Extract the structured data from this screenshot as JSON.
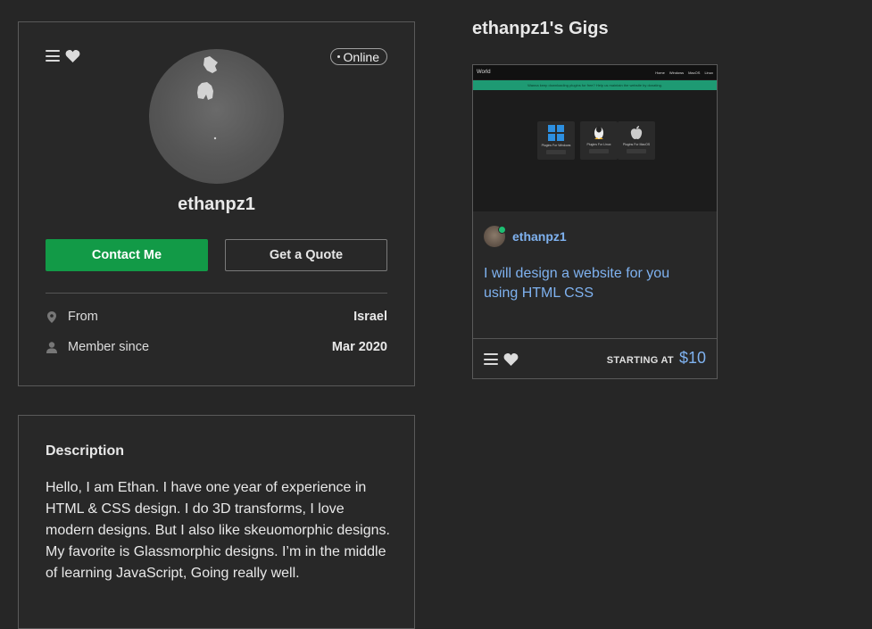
{
  "profile": {
    "status": "Online",
    "username": "ethanpz1",
    "contact_label": "Contact Me",
    "quote_label": "Get a Quote",
    "info": [
      {
        "icon": "location-pin-icon",
        "label": "From",
        "value": "Israel"
      },
      {
        "icon": "user-icon",
        "label": "Member since",
        "value": "Mar 2020"
      }
    ]
  },
  "description": {
    "title": "Description",
    "text": "Hello, I am Ethan. I have one year of experience in HTML & CSS design. I do 3D transforms, I love modern designs. But I also like skeuomorphic designs. My favorite is Glassmorphic designs. I’m in the middle of learning JavaScript, Going really well."
  },
  "gigs": {
    "title": "ethanpz1's Gigs",
    "items": [
      {
        "thumbnail": {
          "site_title": "World",
          "nav_links": [
            "Home",
            "Windows",
            "MacOS",
            "Linux"
          ],
          "banner": "Wanna keep downloading plugins for free? Help us maintain the website by donating.",
          "boxes": [
            "Plugins For Windows",
            "Plugins For Linux",
            "Plugins For MacOS"
          ]
        },
        "seller": "ethanpz1",
        "title": "I will design a website for you using HTML CSS",
        "starting_label": "STARTING AT",
        "price": "$10"
      }
    ]
  },
  "colors": {
    "background": "#262626",
    "accent_green": "#129a47",
    "link_blue": "#7fb2f0",
    "online_green": "#1dbf73"
  }
}
